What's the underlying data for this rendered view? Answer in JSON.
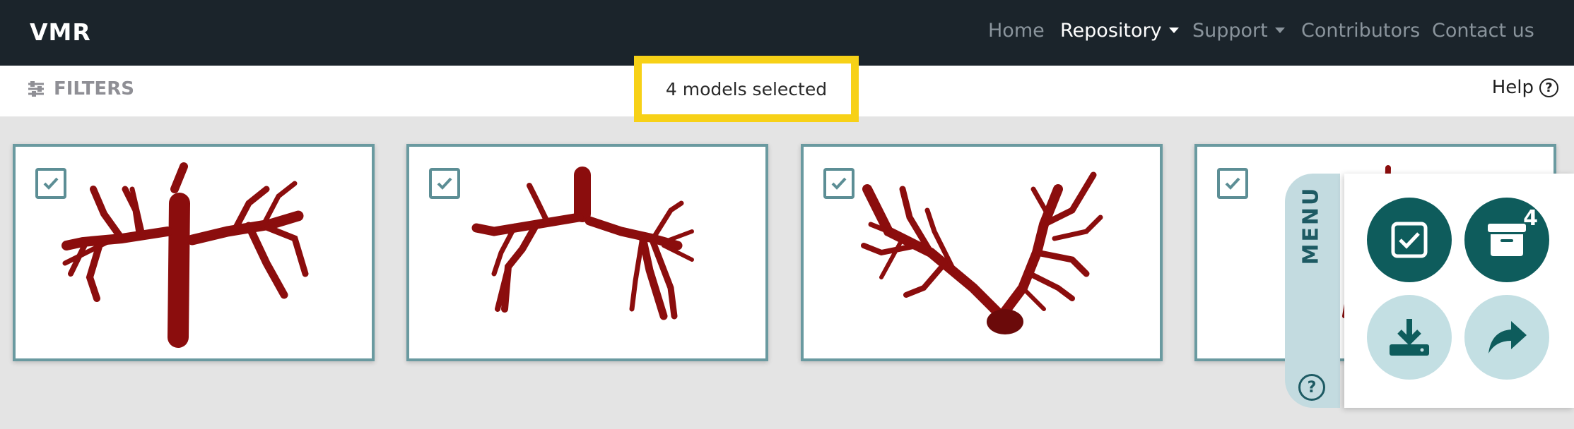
{
  "navbar": {
    "brand": "VMR",
    "links": [
      {
        "label": "Home",
        "active": false
      },
      {
        "label": "Repository",
        "active": true
      },
      {
        "label": "Support",
        "active": false
      },
      {
        "label": "Contributors",
        "active": false
      },
      {
        "label": "Contact us",
        "active": false
      }
    ]
  },
  "subbar": {
    "filters_label": "FILTERS",
    "selection_status": "4 models selected",
    "help_label": "Help"
  },
  "cards": [
    {
      "selected": true
    },
    {
      "selected": true
    },
    {
      "selected": true
    },
    {
      "selected": true
    }
  ],
  "menu": {
    "label": "MENU",
    "help_icon": "question-circle-icon",
    "actions": [
      {
        "name": "select-all",
        "icon": "checkbox-icon"
      },
      {
        "name": "archive",
        "icon": "archive-box-icon",
        "badge": "4"
      },
      {
        "name": "download",
        "icon": "download-icon"
      },
      {
        "name": "share",
        "icon": "share-arrow-icon"
      }
    ]
  },
  "colors": {
    "navbar_bg": "#1b242b",
    "highlight": "#f7d117",
    "card_border": "#6a9aa0",
    "model_red": "#8b0d0d",
    "menu_teal": "#0e5c5c",
    "menu_light": "#c3dfe3"
  }
}
